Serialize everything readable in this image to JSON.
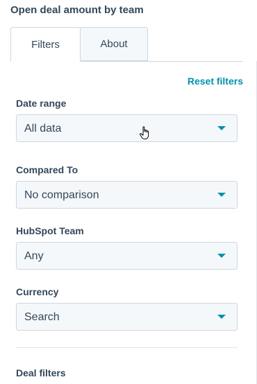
{
  "title": "Open deal amount by team",
  "tabs": [
    {
      "label": "Filters",
      "active": true
    },
    {
      "label": "About",
      "active": false
    }
  ],
  "reset_label": "Reset filters",
  "filters": {
    "date_range": {
      "label": "Date range",
      "value": "All data"
    },
    "compared_to": {
      "label": "Compared To",
      "value": "No comparison"
    },
    "team": {
      "label": "HubSpot Team",
      "value": "Any"
    },
    "currency": {
      "label": "Currency",
      "value": "Search"
    }
  },
  "deal_filters_label": "Deal filters",
  "colors": {
    "text": "#33475b",
    "accent": "#0091ae",
    "border": "#cbd6e2",
    "field_bg": "#f5f8fa"
  },
  "icons": {
    "caret": "caret-down-icon",
    "cursor": "hand-pointer-icon"
  }
}
